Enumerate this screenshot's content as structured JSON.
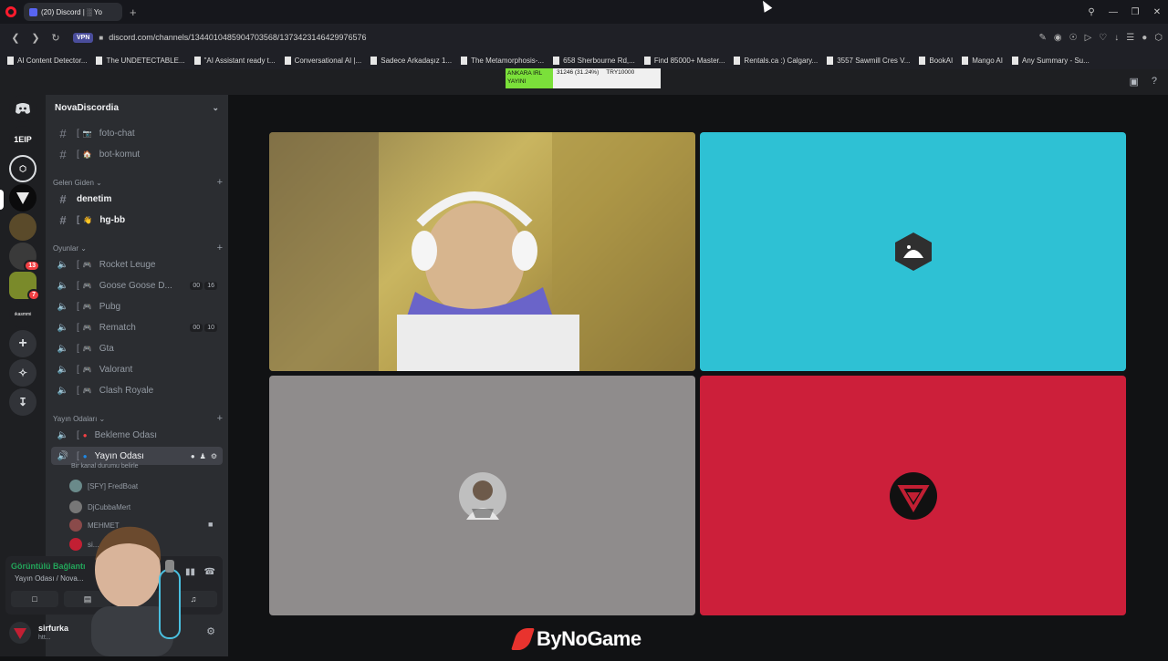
{
  "browser": {
    "tab_title": "(20) Discord | ░ Yo",
    "url": "discord.com/channels/1344010485904703568/1373423146429976576",
    "vpn_label": "VPN",
    "bookmarks": [
      "AI Content Detector...",
      "The UNDETECTABLE...",
      "\"AI Assistant ready t...",
      "Conversational AI |...",
      "Sadece Arkadaşız 1...",
      "The Metamorphosis-...",
      "658 Sherbourne Rd,...",
      "Find 85000+ Master...",
      "Rentals.ca :) Calgary...",
      "3557 Sawmill Cres V...",
      "BookAI",
      "Mango AI",
      "Any Summary - Su..."
    ]
  },
  "ticker": {
    "left_line1": "ANKARA IRL",
    "left_line2": "YAYINI",
    "middle": "31246 (31.24%)",
    "right": "TRY10000"
  },
  "rail": {
    "server_label": "1EIP",
    "badges": [
      "13",
      "7"
    ],
    "text_server": "ıkasmmi"
  },
  "server": {
    "name": "NovaDiscordia"
  },
  "channels_top": [
    {
      "label": "foto-chat",
      "emoji": "📷"
    },
    {
      "label": "bot-komut",
      "emoji": "🏠"
    }
  ],
  "categories": {
    "gelen_giden": "Gelen Giden",
    "oyunlar": "Oyunlar",
    "yayin": "Yayın Odaları"
  },
  "gelen_channels": [
    {
      "label": "denetim",
      "emoji": ""
    },
    {
      "label": "hg-bb",
      "emoji": "👋"
    }
  ],
  "game_channels": [
    {
      "label": "Rocket Leuge"
    },
    {
      "label": "Goose Goose D...",
      "count_a": "00",
      "count_b": "16"
    },
    {
      "label": "Pubg"
    },
    {
      "label": "Rematch",
      "count_a": "00",
      "count_b": "10"
    },
    {
      "label": "Gta"
    },
    {
      "label": "Valorant"
    },
    {
      "label": "Clash Royale"
    }
  ],
  "stream_channels": [
    {
      "label": "Bekleme Odası"
    },
    {
      "label": "Yayın Odası",
      "status": "Bir kanal durumu belirle"
    }
  ],
  "members": [
    "[SFY] FredBoat",
    "DjCubbaMert",
    "MEHMET",
    "si..."
  ],
  "voice": {
    "status": "Görüntülü Bağlantı",
    "channel": "Yayın Odası / Nova..."
  },
  "user": {
    "name": "sirfurka",
    "status": "htt..."
  },
  "brand": "ByNoGame",
  "colors": {
    "tile_cyan": "#2ec1d4",
    "tile_red": "#cc1f3a",
    "tile_gray": "#8f8c8c",
    "discord_blurple": "#5865f2",
    "online_green": "#23a55a"
  }
}
